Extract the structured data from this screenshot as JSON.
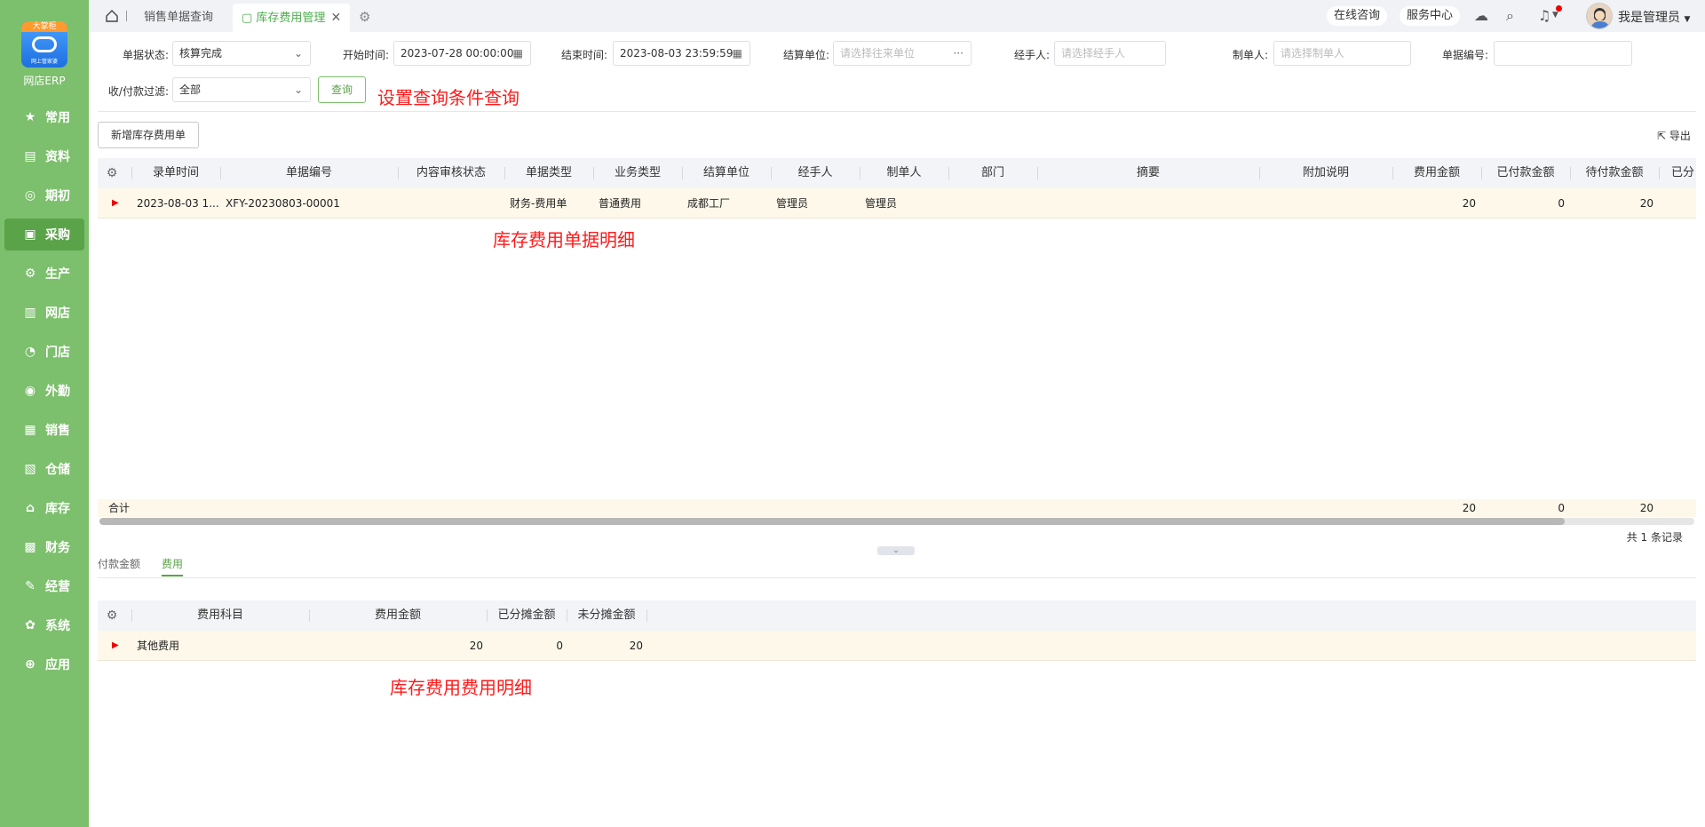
{
  "sidebar": {
    "logo_top": "大掌柜",
    "logo_sub": "网上管家婆",
    "logo_text": "网店ERP",
    "items": [
      {
        "label": "常用",
        "icon": "star-icon"
      },
      {
        "label": "资料",
        "icon": "document-icon"
      },
      {
        "label": "期初",
        "icon": "target-icon"
      },
      {
        "label": "采购",
        "icon": "cart-icon"
      },
      {
        "label": "生产",
        "icon": "gear-doc-icon"
      },
      {
        "label": "网店",
        "icon": "shop-icon"
      },
      {
        "label": "门店",
        "icon": "pie-icon"
      },
      {
        "label": "外勤",
        "icon": "compass-icon"
      },
      {
        "label": "销售",
        "icon": "chart-icon"
      },
      {
        "label": "仓储",
        "icon": "warehouse-icon"
      },
      {
        "label": "库存",
        "icon": "home-icon"
      },
      {
        "label": "财务",
        "icon": "money-icon"
      },
      {
        "label": "经营",
        "icon": "edit-icon"
      },
      {
        "label": "系统",
        "icon": "settings-icon"
      },
      {
        "label": "应用",
        "icon": "plus-icon"
      }
    ],
    "active_index": 3
  },
  "topbar": {
    "tabs": [
      {
        "label": "销售单据查询"
      },
      {
        "label": "库存费用管理"
      }
    ],
    "online_consult": "在线咨询",
    "service_center": "服务中心",
    "username": "我是管理员"
  },
  "filters": {
    "status_label": "单据状态:",
    "status_value": "核算完成",
    "start_label": "开始时间:",
    "start_value": "2023-07-28 00:00:00",
    "end_label": "结束时间:",
    "end_value": "2023-08-03 23:59:59",
    "settle_label": "结算单位:",
    "settle_placeholder": "请选择往来单位",
    "handler_label": "经手人:",
    "handler_placeholder": "请选择经手人",
    "maker_label": "制单人:",
    "maker_placeholder": "请选择制单人",
    "billno_label": "单据编号:",
    "billno_value": "",
    "payfilter_label": "收/付款过滤:",
    "payfilter_value": "全部",
    "query_button": "查询"
  },
  "annotations": {
    "query": "设置查询条件查询",
    "bill_detail": "库存费用单据明细",
    "fee_detail": "库存费用费用明细"
  },
  "toolbar": {
    "new_button": "新增库存费用单",
    "export_label": "导出"
  },
  "main_table": {
    "columns": [
      "录单时间",
      "单据编号",
      "内容审核状态",
      "单据类型",
      "业务类型",
      "结算单位",
      "经手人",
      "制单人",
      "部门",
      "摘要",
      "附加说明",
      "费用金额",
      "已付款金额",
      "待付款金额",
      "已分"
    ],
    "row": {
      "time": "2023-08-03 1...",
      "billno": "XFY-20230803-00001",
      "audit": "",
      "bill_type": "财务-费用单",
      "biz_type": "普通费用",
      "settle": "成都工厂",
      "handler": "管理员",
      "maker": "管理员",
      "dept": "",
      "summary": "",
      "note": "",
      "fee": "20",
      "paid": "0",
      "unpaid": "20"
    },
    "footer": {
      "label": "合计",
      "fee": "20",
      "paid": "0",
      "unpaid": "20"
    },
    "records": "共 1 条记录"
  },
  "subtabs": [
    "付款金额",
    "费用"
  ],
  "fee_table": {
    "columns": [
      "费用科目",
      "费用金额",
      "已分摊金额",
      "未分摊金额"
    ],
    "row": {
      "subject": "其他费用",
      "amount": "20",
      "allocated": "0",
      "unallocated": "20"
    }
  }
}
